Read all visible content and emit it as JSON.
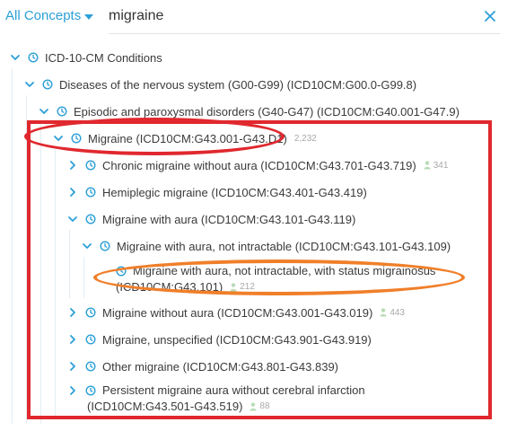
{
  "search": {
    "concept_filter": "All Concepts",
    "query": "migraine",
    "placeholder": ""
  },
  "tree": {
    "root": {
      "label": "ICD-10-CM Conditions"
    },
    "nervous": {
      "label": "Diseases of the nervous system (G00-G99) (ICD10CM:G00.0-G99.8)"
    },
    "episodic": {
      "label": "Episodic and paroxysmal disorders (G40-G47) (ICD10CM:G40.001-G47.9)"
    },
    "migraine": {
      "label": "Migraine (ICD10CM:G43.001-G43.D1)",
      "count": "2,232"
    },
    "chronic": {
      "label": "Chronic migraine without aura (ICD10CM:G43.701-G43.719)",
      "count": "341"
    },
    "hemiplegic": {
      "label": "Hemiplegic migraine (ICD10CM:G43.401-G43.419)"
    },
    "with_aura": {
      "label": "Migraine with aura (ICD10CM:G43.101-G43.119)"
    },
    "aura_not_intractable": {
      "label": "Migraine with aura, not intractable (ICD10CM:G43.101-G43.109)"
    },
    "status_migrainosus": {
      "label_line1": "Migraine with aura, not intractable, with status migrainosus",
      "label_line2": "(ICD10CM:G43.101)",
      "count": "212"
    },
    "without_aura": {
      "label": "Migraine without aura (ICD10CM:G43.001-G43.019)",
      "count": "443"
    },
    "unspecified": {
      "label": "Migraine, unspecified (ICD10CM:G43.901-G43.919)"
    },
    "other": {
      "label": "Other migraine (ICD10CM:G43.801-G43.839)"
    },
    "persistent": {
      "label_line1": "Persistent migraine aura without cerebral infarction",
      "label_line2": "(ICD10CM:G43.501-G43.519)",
      "count": "88"
    }
  },
  "colors": {
    "accent": "#2b9fd6",
    "annotation_red": "#e0282e",
    "annotation_orange": "#f07f2a"
  }
}
